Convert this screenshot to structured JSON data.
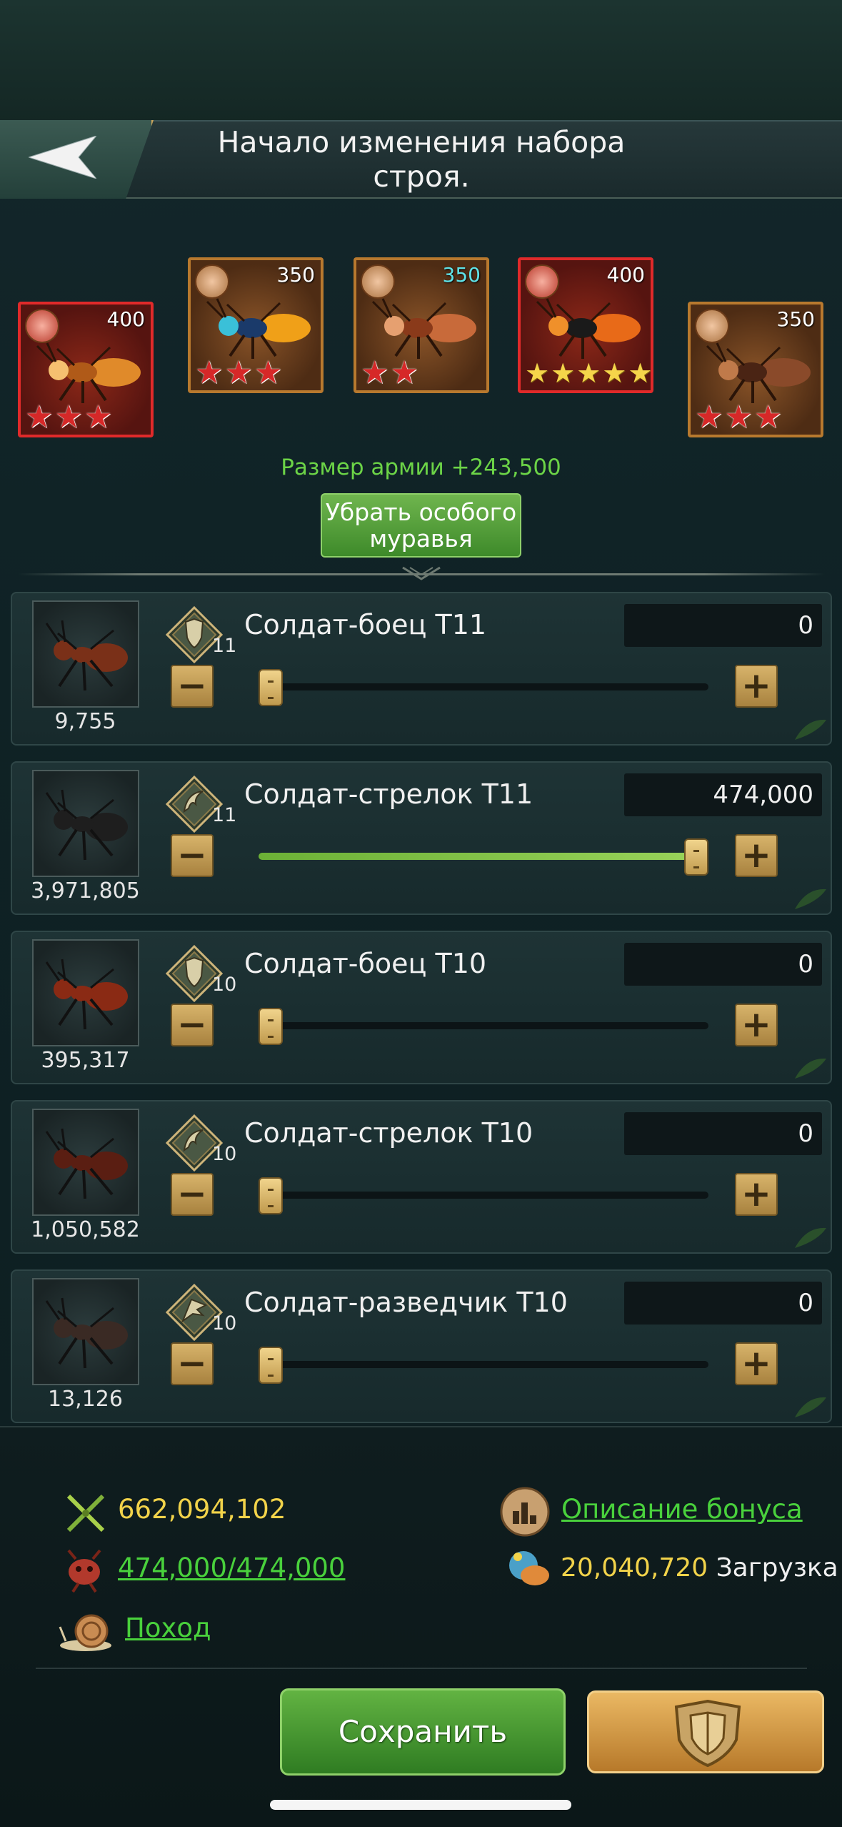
{
  "header": {
    "title_line1": "Начало изменения набора",
    "title_line2": "строя."
  },
  "ant_cards": [
    {
      "power": "400",
      "stars": 3,
      "star_type": "red",
      "frame": "red"
    },
    {
      "power": "350",
      "stars": 3,
      "star_type": "red",
      "frame": "bronze"
    },
    {
      "power": "350",
      "stars": 2,
      "star_type": "red",
      "frame": "bronze",
      "power_color": "cyan"
    },
    {
      "power": "400",
      "stars": 5,
      "star_type": "gold",
      "frame": "red"
    },
    {
      "power": "350",
      "stars": 3,
      "star_type": "red",
      "frame": "bronze"
    }
  ],
  "army_size": "Размер армии +243,500",
  "remove_button": {
    "line1": "Убрать особого",
    "line2": "муравья"
  },
  "troops": [
    {
      "name": "Солдат-боец T11",
      "tier": "11",
      "type_icon": "shield-icon",
      "count": "9,755",
      "value": "0",
      "fill": 0
    },
    {
      "name": "Солдат-стрелок T11",
      "tier": "11",
      "type_icon": "claw-icon",
      "count": "3,971,805",
      "value": "474,000",
      "fill": 1
    },
    {
      "name": "Солдат-боец T10",
      "tier": "10",
      "type_icon": "shield-icon",
      "count": "395,317",
      "value": "0",
      "fill": 0
    },
    {
      "name": "Солдат-стрелок T10",
      "tier": "10",
      "type_icon": "claw-icon",
      "count": "1,050,582",
      "value": "0",
      "fill": 0
    },
    {
      "name": "Солдат-разведчик T10",
      "tier": "10",
      "type_icon": "wing-icon",
      "count": "13,126",
      "value": "0",
      "fill": 0
    }
  ],
  "stats": {
    "power": "662,094,102",
    "capacity": "474,000/474,000",
    "march": "Поход",
    "bonus_link": "Описание бонуса",
    "load_value": "20,040,720",
    "load_label": "Загрузка"
  },
  "buttons": {
    "save": "Сохранить"
  },
  "colors": {
    "accent_green": "#49d13c",
    "gold_text": "#f2d34a",
    "save_green": "#3e8a2a",
    "preset_gold": "#d9a04a"
  }
}
